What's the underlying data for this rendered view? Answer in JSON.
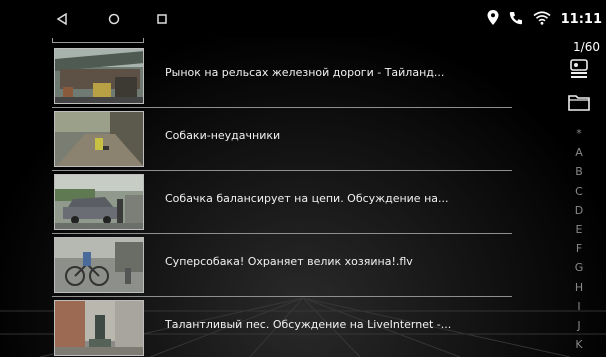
{
  "status": {
    "time": "11:11"
  },
  "counter": "1/60",
  "videos": [
    {
      "title": "Рынок на рельсах железной дороги - Тайланд..."
    },
    {
      "title": "Собаки-неудачники"
    },
    {
      "title": "Собачка балансирует на цепи. Обсуждение на..."
    },
    {
      "title": "Суперсобака! Охраняет велик хозяина!.flv"
    },
    {
      "title": "Талантливый пес. Обсуждение на LiveInternet -..."
    }
  ],
  "index_letters": [
    "*",
    "A",
    "B",
    "C",
    "D",
    "E",
    "F",
    "G",
    "H",
    "I",
    "J",
    "K"
  ],
  "icons": {
    "back": "back-triangle-icon",
    "home": "home-circle-icon",
    "recent": "recent-square-icon",
    "location": "location-pin-icon",
    "phone": "phone-icon",
    "wifi": "wifi-icon",
    "view": "list-view-icon",
    "folder": "folder-icon"
  }
}
